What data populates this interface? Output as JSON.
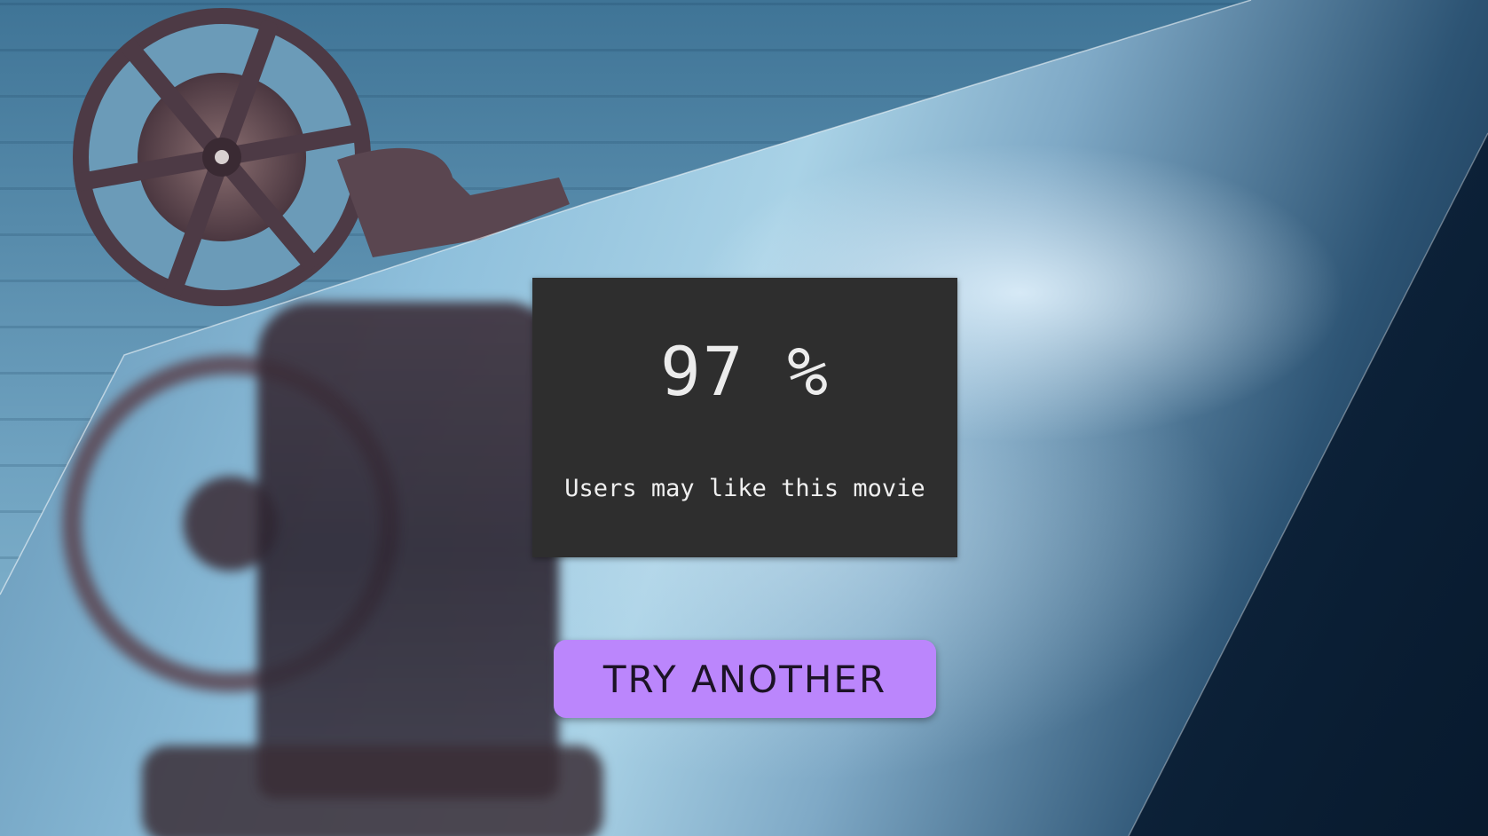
{
  "result": {
    "score": "97 %",
    "caption": "Users may like this movie"
  },
  "actions": {
    "try_another_label": "TRY ANOTHER"
  },
  "colors": {
    "card_background": "#2e2e2e",
    "button_accent": "#bb86fc",
    "text_light": "#ececec"
  },
  "background": {
    "icon": "film-projector-reel-image"
  }
}
